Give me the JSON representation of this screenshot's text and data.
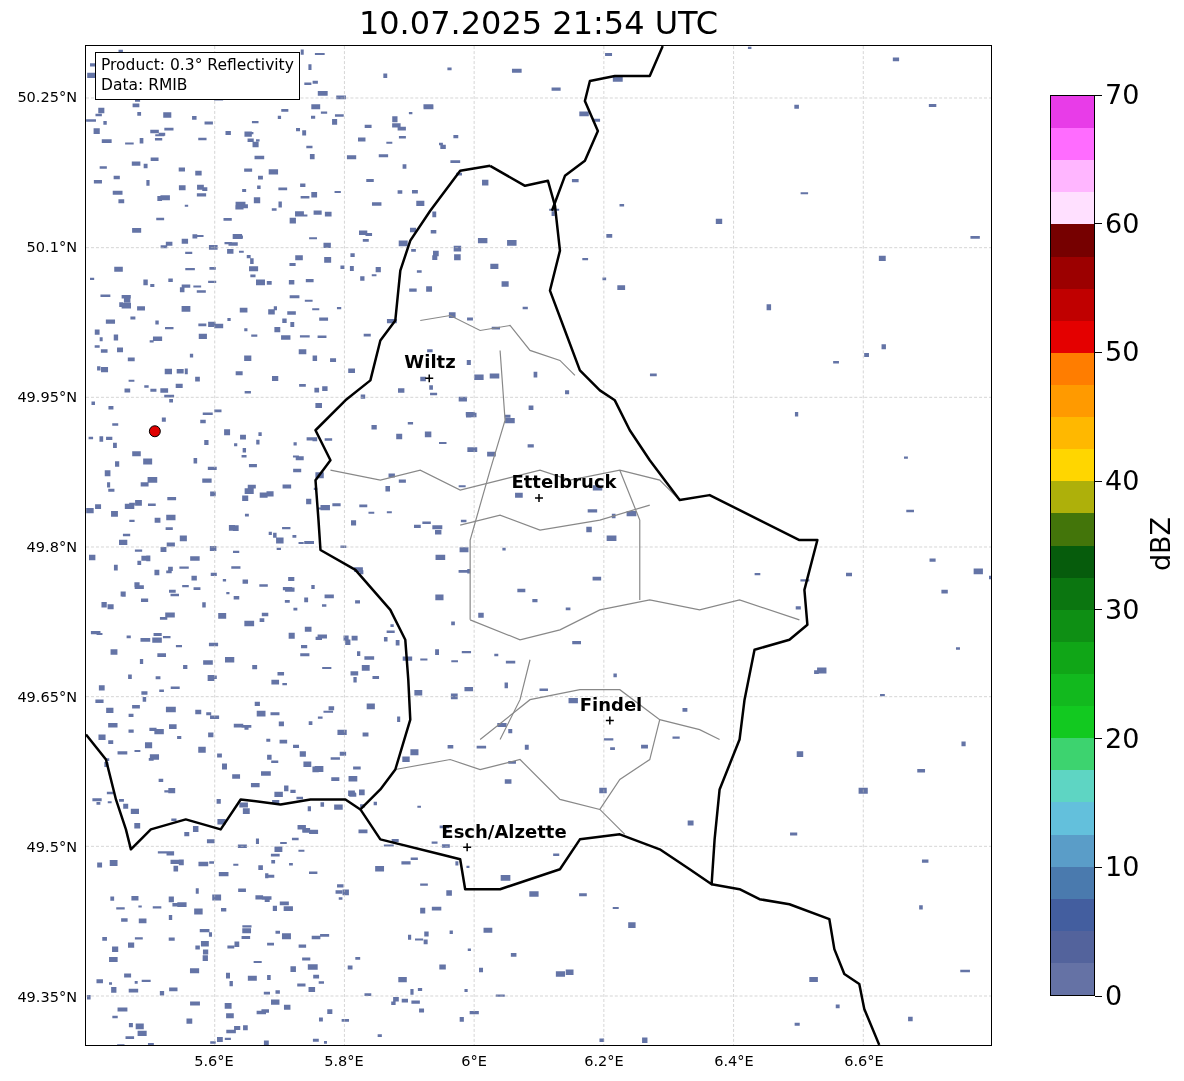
{
  "title": "10.07.2025 21:54 UTC",
  "info_box": {
    "lines": [
      "Product: 0.3° Reflectivity",
      "Data: RMIB"
    ]
  },
  "map": {
    "cities": [
      {
        "name": "Wiltz"
      },
      {
        "name": "Ettelbruck"
      },
      {
        "name": "Findel"
      },
      {
        "name": "Esch/Alzette"
      }
    ],
    "lat_labels": [
      "50.25°N",
      "50.1°N",
      "49.95°N",
      "49.8°N",
      "49.65°N",
      "49.5°N",
      "49.35°N"
    ],
    "lon_labels": [
      "5.6°E",
      "5.8°E",
      "6°E",
      "6.2°E",
      "6.4°E",
      "6.6°E"
    ]
  },
  "colorbar": {
    "label": "dBZ",
    "ticks": [
      "70",
      "60",
      "50",
      "40",
      "30",
      "20",
      "10",
      "0"
    ],
    "segments": [
      {
        "color": "#6572a5"
      },
      {
        "color": "#53639c"
      },
      {
        "color": "#435e9f"
      },
      {
        "color": "#4a7aae"
      },
      {
        "color": "#5a9dc8"
      },
      {
        "color": "#63c0dc"
      },
      {
        "color": "#5ed5c3"
      },
      {
        "color": "#3dd36f"
      },
      {
        "color": "#12c920"
      },
      {
        "color": "#12b91e"
      },
      {
        "color": "#10a617"
      },
      {
        "color": "#0e8f14"
      },
      {
        "color": "#0b7610"
      },
      {
        "color": "#065c0c"
      },
      {
        "color": "#43750a"
      },
      {
        "color": "#aeb00a"
      },
      {
        "color": "#ffd600"
      },
      {
        "color": "#ffb800"
      },
      {
        "color": "#ff9a00"
      },
      {
        "color": "#ff7d00"
      },
      {
        "color": "#e40000"
      },
      {
        "color": "#c00000"
      },
      {
        "color": "#9c0000"
      },
      {
        "color": "#760000"
      },
      {
        "color": "#ffe0ff"
      },
      {
        "color": "#ffb6ff"
      },
      {
        "color": "#ff6cff"
      },
      {
        "color": "#e83ce8"
      }
    ]
  }
}
